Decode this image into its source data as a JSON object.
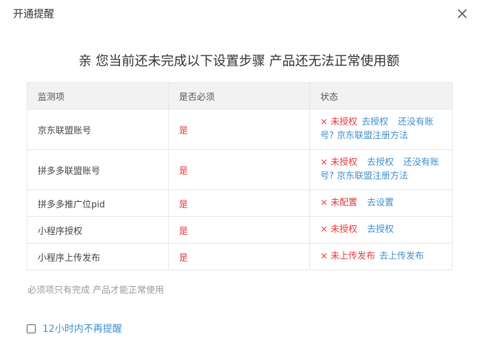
{
  "dialog": {
    "title": "开通提醒",
    "close_icon": "close-icon"
  },
  "headline": "亲 您当前还未完成以下设置步骤 产品还无法正常使用额",
  "table": {
    "headers": [
      "监测项",
      "是否必须",
      "状态"
    ],
    "rows": [
      {
        "item": "京东联盟账号",
        "required": "是",
        "status_x": "×",
        "status_text": "未授权",
        "action": "去授权",
        "extra": "还没有账号? 京东联盟注册方法"
      },
      {
        "item": "拼多多联盟账号",
        "required": "是",
        "status_x": "×",
        "status_text": "未授权",
        "action": "去授权",
        "extra": "还没有账号? 京东联盟注册方法"
      },
      {
        "item": "拼多多推广位pid",
        "required": "是",
        "status_x": "×",
        "status_text": "未配置",
        "action": "去设置",
        "extra": ""
      },
      {
        "item": "小程序授权",
        "required": "是",
        "status_x": "×",
        "status_text": "未授权",
        "action": "去授权",
        "extra": ""
      },
      {
        "item": "小程序上传发布",
        "required": "是",
        "status_x": "×",
        "status_text": "未上传发布",
        "action": "去上传发布",
        "extra": ""
      }
    ]
  },
  "footnote": "必须项只有完成 产品才能正常使用",
  "remind": {
    "label": "12小时内不再提醒",
    "checked": false
  },
  "colors": {
    "error": "#e4393c",
    "link": "#3d8fd0",
    "header_bg": "#f2f2f2",
    "border": "#e6e6e6",
    "muted": "#999999"
  }
}
